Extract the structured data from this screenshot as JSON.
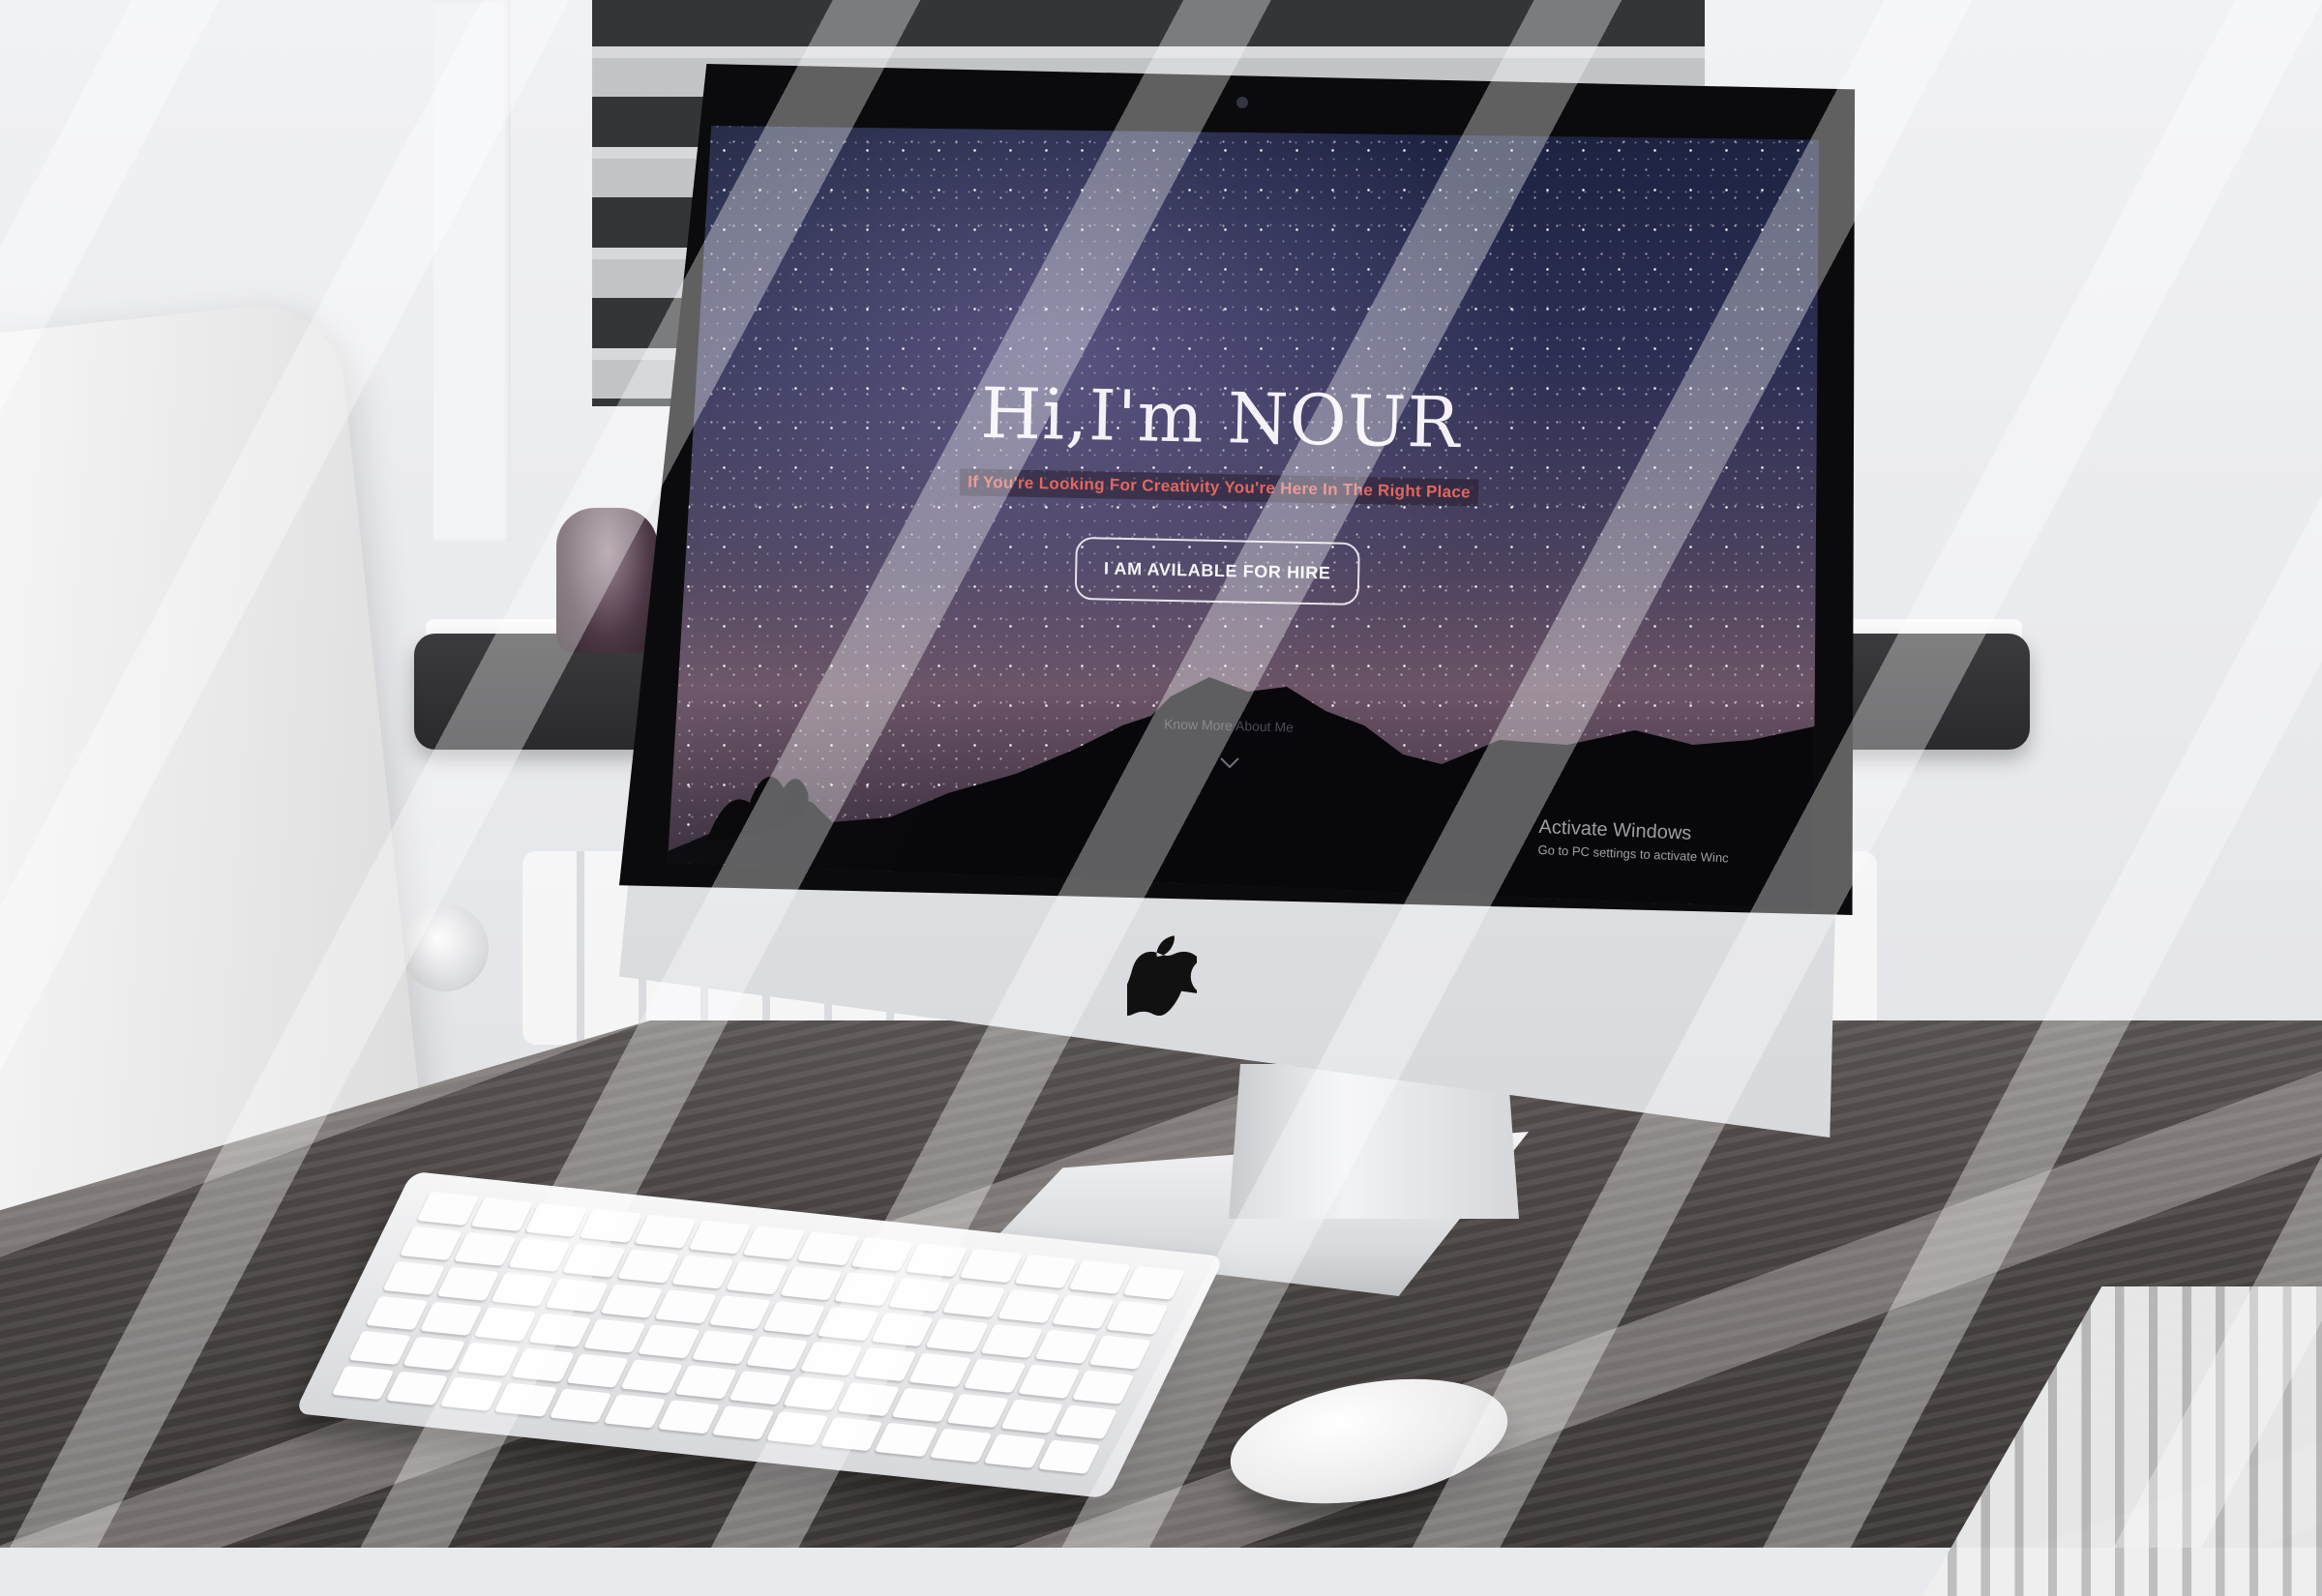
{
  "hero": {
    "title": "Hi,I'm NOUR",
    "tagline": "If You're Looking For Creativity You're Here In The Right Place",
    "cta_label": "I AM AVILABLE FOR HIRE",
    "scroll_hint": "Know More About Me"
  },
  "os_watermark": {
    "title": "Activate Windows",
    "subtitle": "Go to PC settings to activate Winc"
  },
  "colors": {
    "tagline": "#e1675f",
    "title": "#f4f1f6"
  },
  "icons": {
    "scroll": "chevron-down-icon",
    "brand": "apple-logo-icon"
  }
}
